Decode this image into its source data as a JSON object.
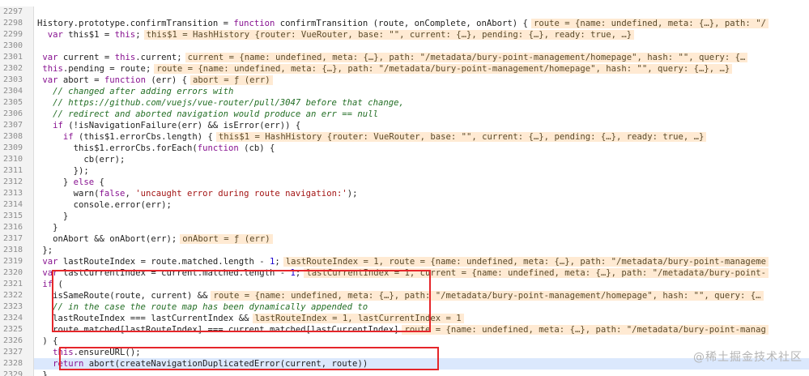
{
  "lines": [
    {
      "n": "2297",
      "parts": []
    },
    {
      "n": "2298",
      "parts": [
        {
          "t": "History.prototype.confirmTransition = ",
          "c": "pl"
        },
        {
          "t": "function",
          "c": "kw"
        },
        {
          "t": " confirmTransition (route, onComplete, onAbort) {",
          "c": "pl"
        },
        {
          "t": "route = {name: undefined, meta: {…}, path: \"/",
          "c": "inl"
        }
      ]
    },
    {
      "n": "2299",
      "parts": [
        {
          "t": "  var",
          "c": "kw"
        },
        {
          "t": " this$1 = ",
          "c": "pl"
        },
        {
          "t": "this",
          "c": "kw"
        },
        {
          "t": ";",
          "c": "pl"
        },
        {
          "t": "this$1 = HashHistory {router: VueRouter, base: \"\", current: {…}, pending: {…}, ready: true, …}",
          "c": "inl"
        }
      ]
    },
    {
      "n": "2300",
      "parts": []
    },
    {
      "n": "2301",
      "parts": [
        {
          "t": " var",
          "c": "kw"
        },
        {
          "t": " current = ",
          "c": "pl"
        },
        {
          "t": "this",
          "c": "kw"
        },
        {
          "t": ".current;",
          "c": "pl"
        },
        {
          "t": "current = {name: undefined, meta: {…}, path: \"/metadata/bury-point-management/homepage\", hash: \"\", query: {…",
          "c": "inl"
        }
      ]
    },
    {
      "n": "2302",
      "parts": [
        {
          "t": " this",
          "c": "kw"
        },
        {
          "t": ".pending = route;",
          "c": "pl"
        },
        {
          "t": "route = {name: undefined, meta: {…}, path: \"/metadata/bury-point-management/homepage\", hash: \"\", query: {…}, …}",
          "c": "inl"
        }
      ]
    },
    {
      "n": "2303",
      "parts": [
        {
          "t": " var",
          "c": "kw"
        },
        {
          "t": " abort = ",
          "c": "pl"
        },
        {
          "t": "function",
          "c": "kw"
        },
        {
          "t": " (err) {",
          "c": "pl"
        },
        {
          "t": "abort = ƒ (err)",
          "c": "inl"
        }
      ]
    },
    {
      "n": "2304",
      "parts": [
        {
          "t": "   // changed after adding errors with",
          "c": "cm"
        }
      ]
    },
    {
      "n": "2305",
      "parts": [
        {
          "t": "   // https://github.com/vuejs/vue-router/pull/3047 before that change,",
          "c": "cm"
        }
      ]
    },
    {
      "n": "2306",
      "parts": [
        {
          "t": "   // redirect and aborted navigation would produce an err == null",
          "c": "cm"
        }
      ]
    },
    {
      "n": "2307",
      "parts": [
        {
          "t": "   if",
          "c": "kw"
        },
        {
          "t": " (!isNavigationFailure(err) && isError(err)) {",
          "c": "pl"
        }
      ]
    },
    {
      "n": "2308",
      "parts": [
        {
          "t": "     if",
          "c": "kw"
        },
        {
          "t": " (this$1.errorCbs.length) {",
          "c": "pl"
        },
        {
          "t": "this$1 = HashHistory {router: VueRouter, base: \"\", current: {…}, pending: {…}, ready: true, …}",
          "c": "inl"
        }
      ]
    },
    {
      "n": "2309",
      "parts": [
        {
          "t": "       this$1.errorCbs.forEach(",
          "c": "pl"
        },
        {
          "t": "function",
          "c": "kw"
        },
        {
          "t": " (cb) {",
          "c": "pl"
        }
      ]
    },
    {
      "n": "2310",
      "parts": [
        {
          "t": "         cb(err);",
          "c": "pl"
        }
      ]
    },
    {
      "n": "2311",
      "parts": [
        {
          "t": "       });",
          "c": "pl"
        }
      ]
    },
    {
      "n": "2312",
      "parts": [
        {
          "t": "     } ",
          "c": "pl"
        },
        {
          "t": "else",
          "c": "kw"
        },
        {
          "t": " {",
          "c": "pl"
        }
      ]
    },
    {
      "n": "2313",
      "parts": [
        {
          "t": "       warn(",
          "c": "pl"
        },
        {
          "t": "false",
          "c": "kw"
        },
        {
          "t": ", ",
          "c": "pl"
        },
        {
          "t": "'uncaught error during route navigation:'",
          "c": "str"
        },
        {
          "t": ");",
          "c": "pl"
        }
      ]
    },
    {
      "n": "2314",
      "parts": [
        {
          "t": "       console.error(err);",
          "c": "pl"
        }
      ]
    },
    {
      "n": "2315",
      "parts": [
        {
          "t": "     }",
          "c": "pl"
        }
      ]
    },
    {
      "n": "2316",
      "parts": [
        {
          "t": "   }",
          "c": "pl"
        }
      ]
    },
    {
      "n": "2317",
      "parts": [
        {
          "t": "   onAbort && onAbort(err);",
          "c": "pl"
        },
        {
          "t": "onAbort = ƒ (err)",
          "c": "inl"
        }
      ]
    },
    {
      "n": "2318",
      "parts": [
        {
          "t": " };",
          "c": "pl"
        }
      ]
    },
    {
      "n": "2319",
      "parts": [
        {
          "t": " var",
          "c": "kw"
        },
        {
          "t": " lastRouteIndex = route.matched.length - ",
          "c": "pl"
        },
        {
          "t": "1",
          "c": "num"
        },
        {
          "t": ";",
          "c": "pl"
        },
        {
          "t": "lastRouteIndex = 1, route = {name: undefined, meta: {…}, path: \"/metadata/bury-point-manageme",
          "c": "inl"
        }
      ]
    },
    {
      "n": "2320",
      "parts": [
        {
          "t": " var",
          "c": "kw"
        },
        {
          "t": " lastCurrentIndex = current.matched.length - ",
          "c": "pl"
        },
        {
          "t": "1",
          "c": "num"
        },
        {
          "t": ";",
          "c": "pl"
        },
        {
          "t": "lastCurrentIndex = 1, current = {name: undefined, meta: {…}, path: \"/metadata/bury-point-",
          "c": "inl"
        }
      ]
    },
    {
      "n": "2321",
      "parts": [
        {
          "t": " if",
          "c": "kw"
        },
        {
          "t": " (",
          "c": "pl"
        }
      ]
    },
    {
      "n": "2322",
      "parts": [
        {
          "t": "   isSameRoute(route, current) &&",
          "c": "pl"
        },
        {
          "t": "route = {name: undefined, meta: {…}, path: \"/metadata/bury-point-management/homepage\", hash: \"\", query: {…",
          "c": "inl"
        }
      ]
    },
    {
      "n": "2323",
      "parts": [
        {
          "t": "   // in the case the route map has been dynamically appended to",
          "c": "cm"
        }
      ]
    },
    {
      "n": "2324",
      "parts": [
        {
          "t": "   lastRouteIndex === lastCurrentIndex &&",
          "c": "pl"
        },
        {
          "t": "lastRouteIndex = 1, lastCurrentIndex = 1",
          "c": "inl"
        }
      ]
    },
    {
      "n": "2325",
      "parts": [
        {
          "t": "   route.matched[lastRouteIndex] === current.matched[lastCurrentIndex]",
          "c": "pl"
        },
        {
          "t": "route = {name: undefined, meta: {…}, path: \"/metadata/bury-point-manag",
          "c": "inl"
        }
      ]
    },
    {
      "n": "2326",
      "parts": [
        {
          "t": " ) {",
          "c": "pl"
        }
      ]
    },
    {
      "n": "2327",
      "parts": [
        {
          "t": "   this",
          "c": "kw"
        },
        {
          "t": ".ensureURL();",
          "c": "pl"
        }
      ]
    },
    {
      "n": "2328",
      "highlight": true,
      "parts": [
        {
          "t": "   return",
          "c": "kw"
        },
        {
          "t": " abort(createNavigationDuplicatedError(current, route))",
          "c": "pl"
        }
      ]
    },
    {
      "n": "2329",
      "parts": [
        {
          "t": " }",
          "c": "pl"
        }
      ]
    }
  ],
  "watermark": "@稀土掘金技术社区"
}
